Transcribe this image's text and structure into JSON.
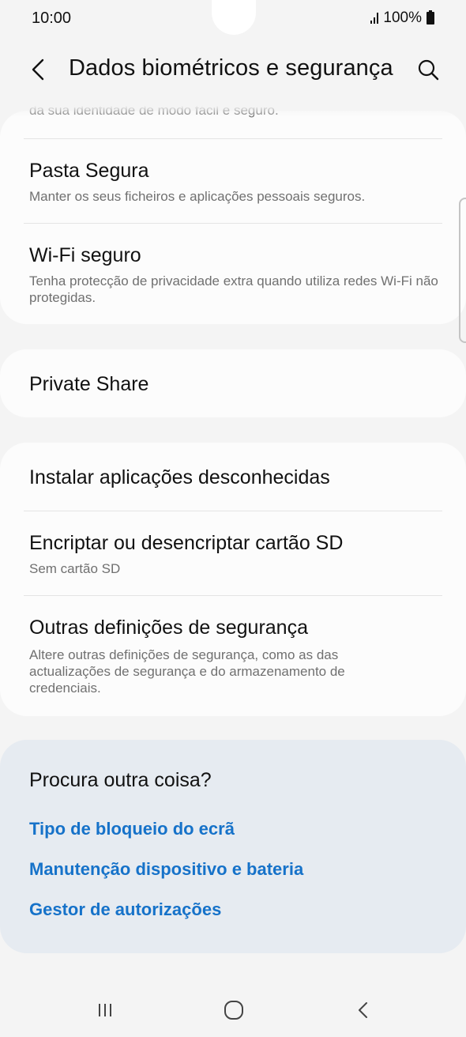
{
  "status_bar": {
    "time": "10:00",
    "battery_percent": "100%",
    "signal_icon": "signal-bars-icon",
    "battery_icon": "battery-full-icon"
  },
  "app_bar": {
    "title": "Dados biométricos e segurança",
    "back_icon": "chevron-left-icon",
    "search_icon": "search-icon"
  },
  "clipped_previous_text": "da sua identidade de modo fácil e seguro.",
  "card1": {
    "items": [
      {
        "title": "Pasta Segura",
        "subtitle": "Manter os seus ficheiros e aplicações pessoais seguros."
      },
      {
        "title": "Wi-Fi seguro",
        "subtitle": "Tenha protecção de privacidade extra quando utiliza redes Wi-Fi não protegidas."
      }
    ]
  },
  "card2": {
    "items": [
      {
        "title": "Private Share"
      }
    ]
  },
  "card3": {
    "items": [
      {
        "title": "Instalar aplicações desconhecidas"
      },
      {
        "title": "Encriptar ou desencriptar cartão SD",
        "subtitle": "Sem cartão SD"
      },
      {
        "title": "Outras definições de segurança",
        "subtitle": "Altere outras definições de segurança, como as das actualizações de segurança e do armazenamento de credenciais."
      }
    ]
  },
  "suggestions": {
    "title": "Procura outra coisa?",
    "links": [
      "Tipo de bloqueio do ecrã",
      "Manutenção dispositivo e bateria",
      "Gestor de autorizações"
    ],
    "link_color": "#1672c9"
  },
  "nav_bar": {
    "recents_icon": "recent-apps-icon",
    "home_icon": "home-icon",
    "back_icon": "back-icon"
  },
  "colors": {
    "background": "#f4f4f4",
    "card": "#fcfcfc",
    "suggestion_card": "#e6ebf1",
    "secondary_text": "#707070"
  }
}
